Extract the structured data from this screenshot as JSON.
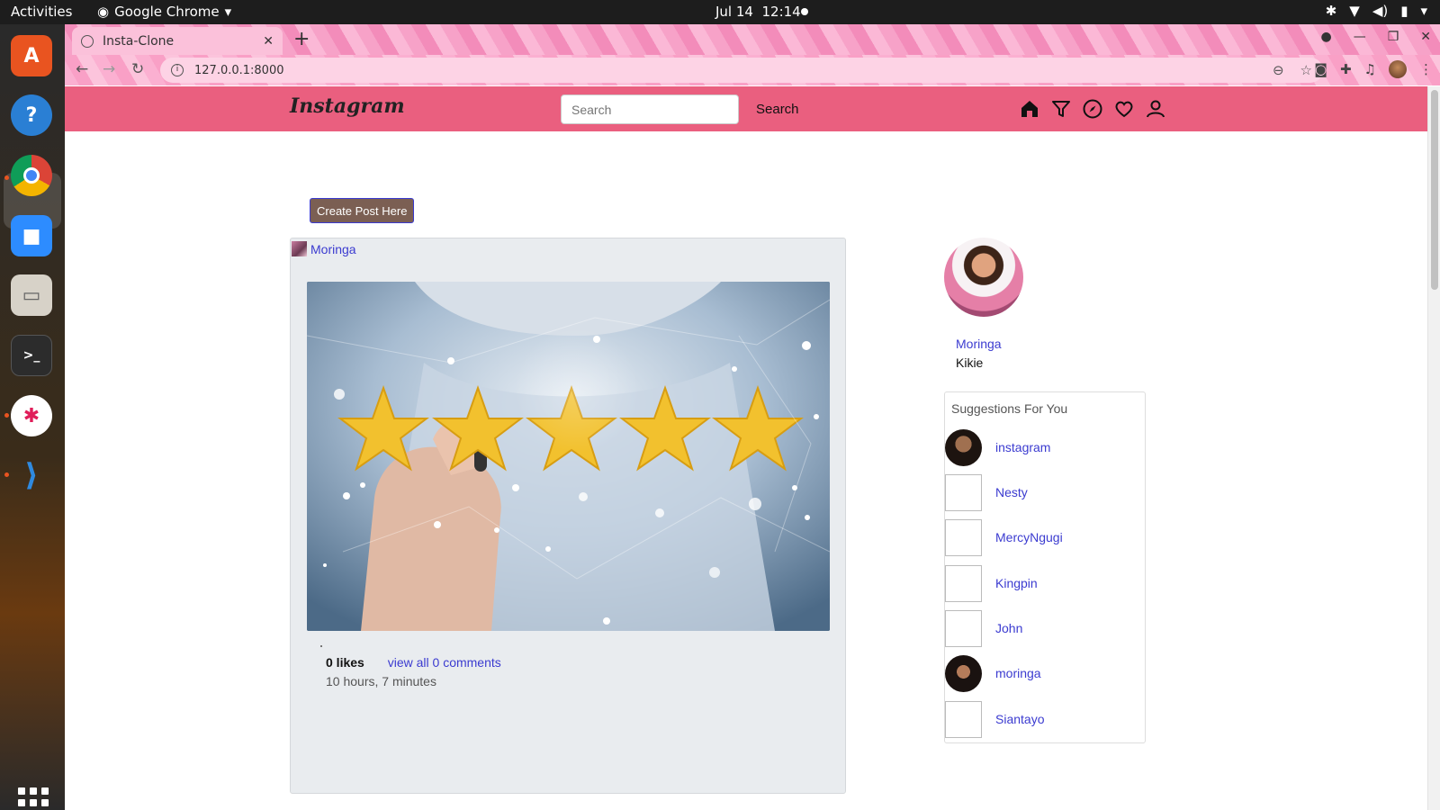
{
  "system": {
    "activities": "Activities",
    "app_name": "Google Chrome",
    "date": "Jul 14",
    "time": "12:14"
  },
  "dock": {
    "items": [
      "ubuntu-software",
      "help",
      "google-chrome",
      "zoom",
      "files",
      "terminal",
      "slack",
      "vscode"
    ]
  },
  "browser": {
    "tab_title": "Insta-Clone",
    "url": "127.0.0.1:8000"
  },
  "site": {
    "brand": "Instagram",
    "search_placeholder": "Search",
    "search_button": "Search",
    "create_post": "Create Post Here",
    "post": {
      "author": "Moringa",
      "likes": "0 likes",
      "comments_link": "view all 0 comments",
      "timestamp": "10 hours, 7 minutes"
    },
    "profile": {
      "username": "Moringa",
      "subtitle": "Kikie"
    },
    "suggestions": {
      "title": "Suggestions For You",
      "users": [
        {
          "name": "instagram",
          "has_photo": true
        },
        {
          "name": "Nesty",
          "has_photo": false
        },
        {
          "name": "MercyNgugi",
          "has_photo": false
        },
        {
          "name": "Kingpin",
          "has_photo": false
        },
        {
          "name": "John",
          "has_photo": false
        },
        {
          "name": "moringa",
          "has_photo": true
        },
        {
          "name": "Siantayo",
          "has_photo": false
        }
      ]
    }
  },
  "colors": {
    "navbar": "#ea5f7f",
    "link": "#3b3bd0",
    "create_button": "#7b5f53",
    "post_card": "#e9ecef"
  }
}
